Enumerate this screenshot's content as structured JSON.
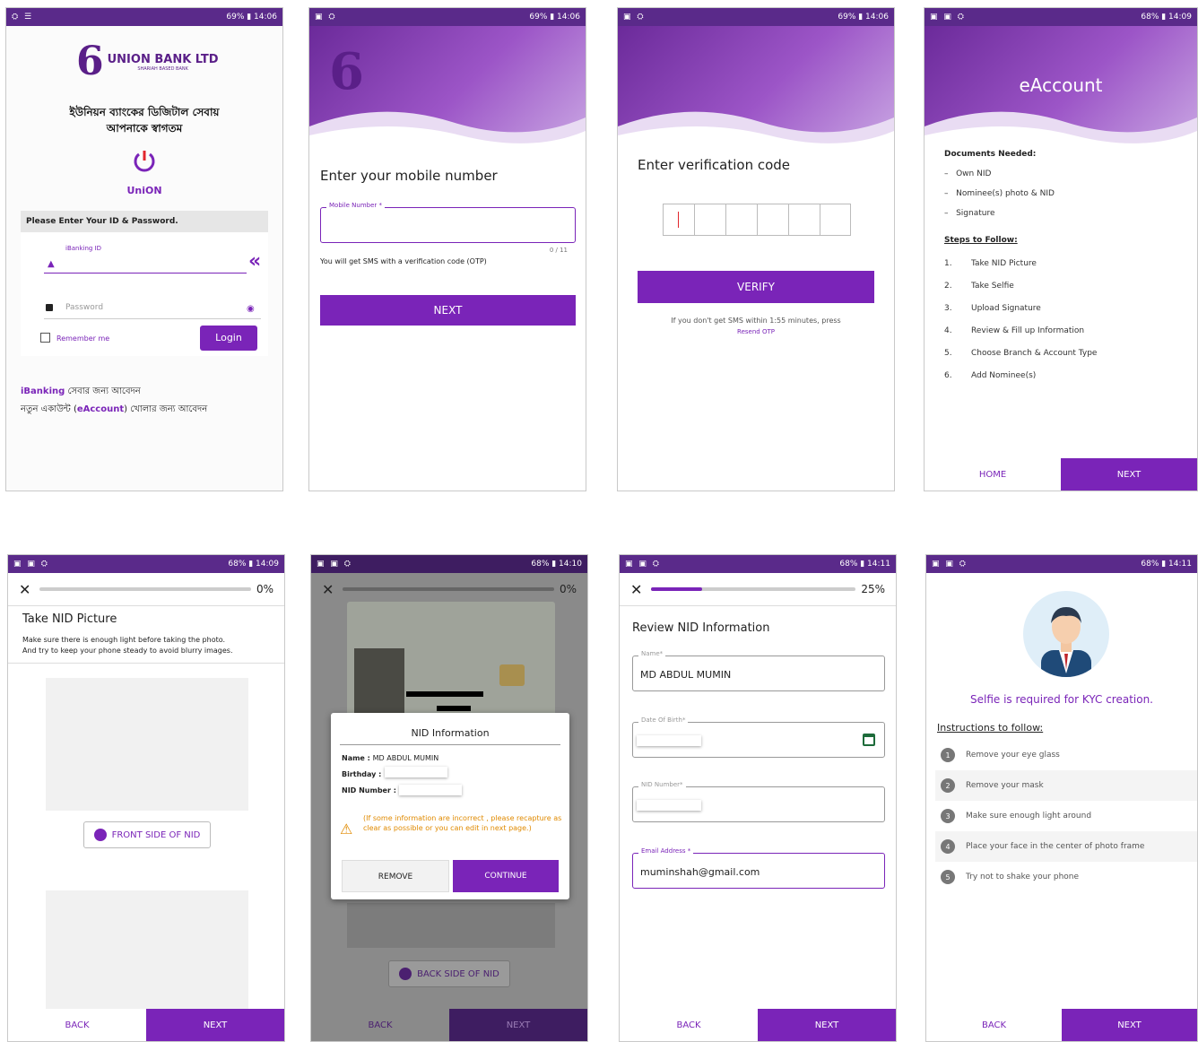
{
  "status": {
    "s1": "69% ▮ 14:06",
    "s2": "69% ▮ 14:06",
    "s3": "69% ▮ 14:06",
    "s4": "68% ▮ 14:09",
    "s5": "68% ▮ 14:09",
    "s6": "68% ▮ 14:10",
    "s7": "68% ▮ 14:11",
    "s8": "68% ▮ 14:11"
  },
  "login": {
    "bank_name": "UNION BANK LTD",
    "bank_sub": "SHARIAH BASED BANK",
    "welcome_1": "ইউনিয়ন ব্যাংকের ডিজিটাল সেবায়",
    "welcome_2": "আপনাকে স্বাগতম",
    "app_name": "UniON",
    "prompt": "Please Enter Your ID & Password.",
    "id_label": "iBanking ID",
    "password_placeholder": "Password",
    "remember": "Remember me",
    "login_button": "Login",
    "link1_a": "iBanking",
    "link1_b": " সেবার জন্য আবেদন",
    "link2_a": "নতুন একাউন্ট (",
    "link2_b": "eAccount",
    "link2_c": ") খোলার জন্য আবেদন"
  },
  "mobile": {
    "title": "Enter your mobile number",
    "label": "Mobile Number *",
    "counter": "0 / 11",
    "hint": "You will get SMS with a verification code (OTP)",
    "next": "NEXT"
  },
  "verify": {
    "title": "Enter verification code",
    "button": "VERIFY",
    "note": "If you don't get SMS within 1:55 minutes, press",
    "resend": "Resend OTP"
  },
  "eaccount": {
    "title": "eAccount",
    "docs_heading": "Documents Needed:",
    "docs": [
      "Own NID",
      "Nominee(s) photo & NID",
      "Signature"
    ],
    "steps_heading": "Steps to Follow:",
    "steps": [
      {
        "n": "1.",
        "t": "Take NID Picture"
      },
      {
        "n": "2.",
        "t": "Take Selfie"
      },
      {
        "n": "3.",
        "t": "Upload Signature"
      },
      {
        "n": "4.",
        "t": "Review & Fill up Information"
      },
      {
        "n": "5.",
        "t": "Choose Branch & Account Type"
      },
      {
        "n": "6.",
        "t": "Add Nominee(s)"
      }
    ],
    "home": "HOME",
    "next": "NEXT"
  },
  "nidpic": {
    "pct": "0%",
    "progress": 0,
    "title": "Take NID Picture",
    "desc1": "Make sure there is enough light before taking the photo.",
    "desc2": "And try to keep your phone steady to avoid blurry images.",
    "front": "FRONT SIDE OF NID",
    "back": "BACK",
    "next": "NEXT"
  },
  "nidinfo": {
    "pct": "0%",
    "progress": 0,
    "dialog_title": "NID Information",
    "name_label": "Name : ",
    "name_value": "MD ABDUL MUMIN",
    "birthday_label": "Birthday :",
    "nid_label": "NID Number :",
    "warning": "(If some information are incorrect , please recapture as clear as possible or you can edit in next page.)",
    "remove": "REMOVE",
    "continue": "CONTINUE",
    "back_side": "BACK SIDE OF NID",
    "back": "BACK",
    "next": "NEXT"
  },
  "review": {
    "pct": "25%",
    "progress": 0.25,
    "title": "Review NID Information",
    "name_label": "Name*",
    "name_value": "MD ABDUL MUMIN",
    "dob_label": "Date Of Birth*",
    "nid_label": "NID Number*",
    "email_label": "Email Address *",
    "email_value": "muminshah@gmail.com",
    "back": "BACK",
    "next": "NEXT"
  },
  "selfie": {
    "heading": "Selfie is required for KYC creation.",
    "inst_heading": "Instructions to follow:",
    "items": [
      {
        "n": "1",
        "t": "Remove your eye glass"
      },
      {
        "n": "2",
        "t": "Remove your mask"
      },
      {
        "n": "3",
        "t": "Make sure enough light around"
      },
      {
        "n": "4",
        "t": "Place your face in the center of photo frame"
      },
      {
        "n": "5",
        "t": "Try not to shake your phone"
      }
    ],
    "back": "BACK",
    "next": "NEXT"
  },
  "colors": {
    "brand": "#7a24b8",
    "status": "#5a2a8a"
  }
}
